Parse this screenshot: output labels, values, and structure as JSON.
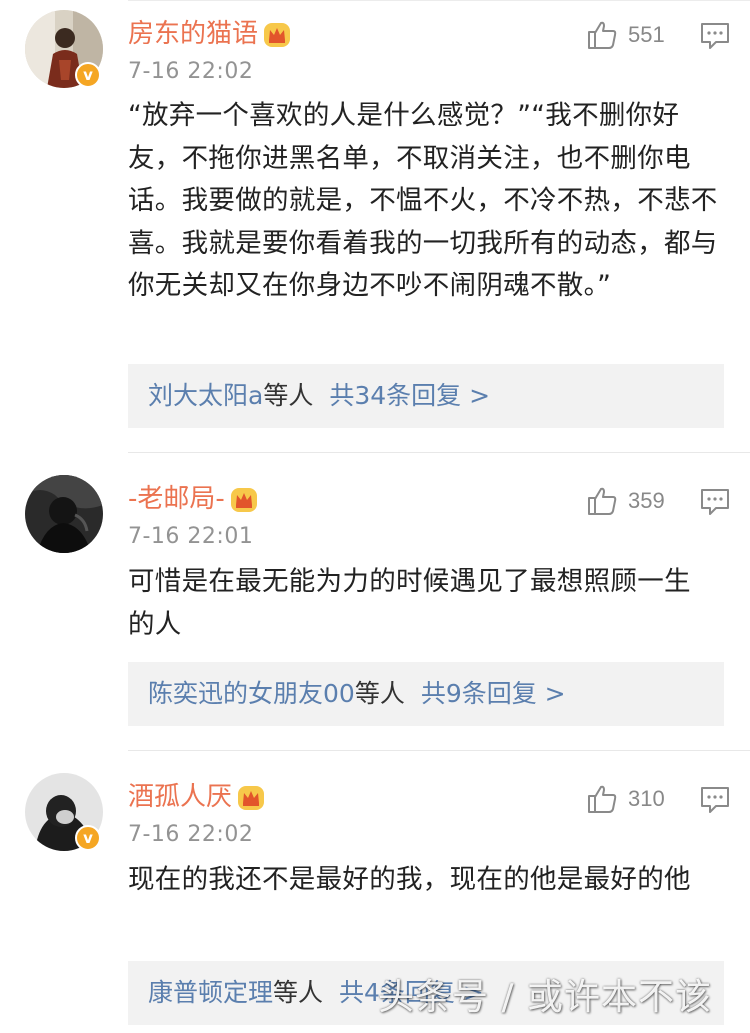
{
  "comments": [
    {
      "username": "房东的猫语",
      "time": "7-16 22:02",
      "likes": "551",
      "verified": true,
      "text": "“放弃一个喜欢的人是什么感觉？”“我不删你好友，不拖你进黑名单，不取消关注，也不删你电话。我要做的就是，不愠不火，不冷不热，不悲不喜。我就是要你看着我的一切我所有的动态，都与你无关却又在你身边不吵不闹阴魂不散。”",
      "reply_names": "刘大太阳a",
      "reply_suffix": "等人",
      "reply_total": "共34条回复 >"
    },
    {
      "username": "-老邮局-",
      "time": "7-16 22:01",
      "likes": "359",
      "verified": false,
      "text": "可惜是在最无能为力的时候遇见了最想照顾一生的人",
      "reply_names": "陈奕迅的女朋友00",
      "reply_suffix": "等人",
      "reply_total": "共9条回复 >"
    },
    {
      "username": "酒孤人厌",
      "time": "7-16 22:02",
      "likes": "310",
      "verified": true,
      "text": "现在的我还不是最好的我，现在的他是最好的他",
      "reply_names": "康普顿定理",
      "reply_suffix": "等人",
      "reply_total": "共4条回复 >"
    }
  ],
  "icons": {
    "like": "thumbs-up-icon",
    "reply": "comment-icon",
    "crown": "crown-badge-icon",
    "verified": "verified-v-icon"
  },
  "colors": {
    "username": "#eb7350",
    "reply_link": "#5b7fae",
    "time": "#939393",
    "verified_badge": "#f5a623"
  },
  "watermark": "头条号 / 或许本不该"
}
